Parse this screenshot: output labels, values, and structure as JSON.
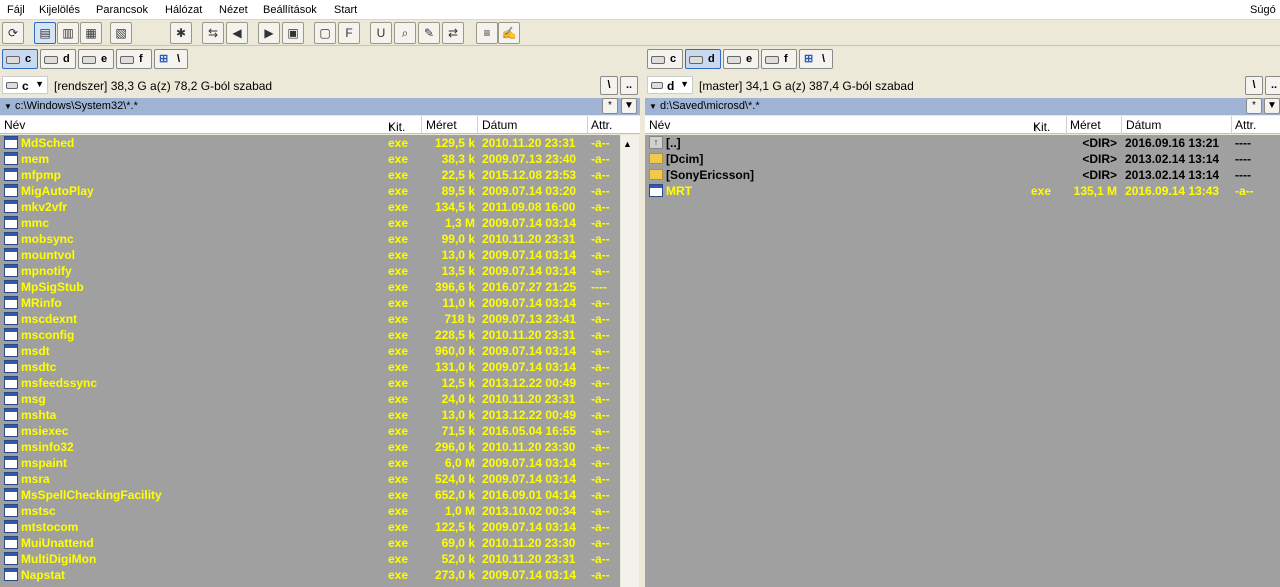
{
  "menu": [
    "Fájl",
    "Kijelölés",
    "Parancsok",
    "Hálózat",
    "Nézet",
    "Beállítások",
    "Start"
  ],
  "help_label": "Súgó",
  "toolbar_icons": [
    "refresh-icon",
    "brief-view-icon",
    "full-view-icon",
    "thumbnails-icon",
    "tree-icon",
    "invert-selection-icon",
    "compare-icon",
    "back-icon",
    "forward-icon",
    "pack-icon",
    "unpack-icon",
    "ftp-icon",
    "url-icon",
    "find-icon",
    "rename-icon",
    "sync-icon",
    "compare-files-icon",
    "notepad-icon"
  ],
  "left": {
    "drives": [
      "c",
      "d",
      "e",
      "f"
    ],
    "active_drive": "c",
    "net_label": "\\",
    "combo_letter": "c",
    "free_text": "[rendszer]  38,3 G a(z) 78,2 G-ból szabad",
    "root_btn": "\\",
    "up_btn": "..",
    "path": "c:\\Windows\\System32\\*.*",
    "star_btn": "*",
    "header": {
      "name": "Név",
      "ext": "Kit.",
      "size": "Méret",
      "date": "Dátum",
      "attr": "Attr."
    },
    "rows": [
      {
        "name": "MdSched",
        "ext": "exe",
        "size": "129,5 k",
        "date": "2010.11.20 23:31",
        "attr": "-a--"
      },
      {
        "name": "mem",
        "ext": "exe",
        "size": "38,3 k",
        "date": "2009.07.13 23:40",
        "attr": "-a--"
      },
      {
        "name": "mfpmp",
        "ext": "exe",
        "size": "22,5 k",
        "date": "2015.12.08 23:53",
        "attr": "-a--"
      },
      {
        "name": "MigAutoPlay",
        "ext": "exe",
        "size": "89,5 k",
        "date": "2009.07.14 03:20",
        "attr": "-a--"
      },
      {
        "name": "mkv2vfr",
        "ext": "exe",
        "size": "134,5 k",
        "date": "2011.09.08 16:00",
        "attr": "-a--"
      },
      {
        "name": "mmc",
        "ext": "exe",
        "size": "1,3 M",
        "date": "2009.07.14 03:14",
        "attr": "-a--"
      },
      {
        "name": "mobsync",
        "ext": "exe",
        "size": "99,0 k",
        "date": "2010.11.20 23:31",
        "attr": "-a--"
      },
      {
        "name": "mountvol",
        "ext": "exe",
        "size": "13,0 k",
        "date": "2009.07.14 03:14",
        "attr": "-a--"
      },
      {
        "name": "mpnotify",
        "ext": "exe",
        "size": "13,5 k",
        "date": "2009.07.14 03:14",
        "attr": "-a--"
      },
      {
        "name": "MpSigStub",
        "ext": "exe",
        "size": "396,6 k",
        "date": "2016.07.27 21:25",
        "attr": "----"
      },
      {
        "name": "MRinfo",
        "ext": "exe",
        "size": "11,0 k",
        "date": "2009.07.14 03:14",
        "attr": "-a--"
      },
      {
        "name": "mscdexnt",
        "ext": "exe",
        "size": "718 b",
        "date": "2009.07.13 23:41",
        "attr": "-a--"
      },
      {
        "name": "msconfig",
        "ext": "exe",
        "size": "228,5 k",
        "date": "2010.11.20 23:31",
        "attr": "-a--"
      },
      {
        "name": "msdt",
        "ext": "exe",
        "size": "960,0 k",
        "date": "2009.07.14 03:14",
        "attr": "-a--"
      },
      {
        "name": "msdtc",
        "ext": "exe",
        "size": "131,0 k",
        "date": "2009.07.14 03:14",
        "attr": "-a--"
      },
      {
        "name": "msfeedssync",
        "ext": "exe",
        "size": "12,5 k",
        "date": "2013.12.22 00:49",
        "attr": "-a--"
      },
      {
        "name": "msg",
        "ext": "exe",
        "size": "24,0 k",
        "date": "2010.11.20 23:31",
        "attr": "-a--"
      },
      {
        "name": "mshta",
        "ext": "exe",
        "size": "13,0 k",
        "date": "2013.12.22 00:49",
        "attr": "-a--"
      },
      {
        "name": "msiexec",
        "ext": "exe",
        "size": "71,5 k",
        "date": "2016.05.04 16:55",
        "attr": "-a--"
      },
      {
        "name": "msinfo32",
        "ext": "exe",
        "size": "296,0 k",
        "date": "2010.11.20 23:30",
        "attr": "-a--"
      },
      {
        "name": "mspaint",
        "ext": "exe",
        "size": "6,0 M",
        "date": "2009.07.14 03:14",
        "attr": "-a--"
      },
      {
        "name": "msra",
        "ext": "exe",
        "size": "524,0 k",
        "date": "2009.07.14 03:14",
        "attr": "-a--"
      },
      {
        "name": "MsSpellCheckingFacility",
        "ext": "exe",
        "size": "652,0 k",
        "date": "2016.09.01 04:14",
        "attr": "-a--"
      },
      {
        "name": "mstsc",
        "ext": "exe",
        "size": "1,0 M",
        "date": "2013.10.02 00:34",
        "attr": "-a--"
      },
      {
        "name": "mtstocom",
        "ext": "exe",
        "size": "122,5 k",
        "date": "2009.07.14 03:14",
        "attr": "-a--"
      },
      {
        "name": "MuiUnattend",
        "ext": "exe",
        "size": "69,0 k",
        "date": "2010.11.20 23:30",
        "attr": "-a--"
      },
      {
        "name": "MultiDigiMon",
        "ext": "exe",
        "size": "52,0 k",
        "date": "2010.11.20 23:31",
        "attr": "-a--"
      },
      {
        "name": "Napstat",
        "ext": "exe",
        "size": "273,0 k",
        "date": "2009.07.14 03:14",
        "attr": "-a--"
      }
    ]
  },
  "right": {
    "drives": [
      "c",
      "d",
      "e",
      "f"
    ],
    "active_drive": "d",
    "net_label": "\\",
    "combo_letter": "d",
    "free_text": "[master]  34,1 G a(z) 387,4 G-ból szabad",
    "root_btn": "\\",
    "up_btn": "..",
    "path": "d:\\Saved\\microsd\\*.*",
    "star_btn": "*",
    "header": {
      "name": "Név",
      "ext": "Kit.",
      "size": "Méret",
      "date": "Dátum",
      "attr": "Attr."
    },
    "rows": [
      {
        "name": "[..]",
        "ext": "",
        "size": "<DIR>",
        "date": "2016.09.16 13:21",
        "attr": "----",
        "kind": "up"
      },
      {
        "name": "[Dcim]",
        "ext": "",
        "size": "<DIR>",
        "date": "2013.02.14 13:14",
        "attr": "----",
        "kind": "dir"
      },
      {
        "name": "[SonyEricsson]",
        "ext": "",
        "size": "<DIR>",
        "date": "2013.02.14 13:14",
        "attr": "----",
        "kind": "dir"
      },
      {
        "name": "MRT",
        "ext": "exe",
        "size": "135,1 M",
        "date": "2016.09.14 13:43",
        "attr": "-a--",
        "kind": "file"
      }
    ]
  }
}
